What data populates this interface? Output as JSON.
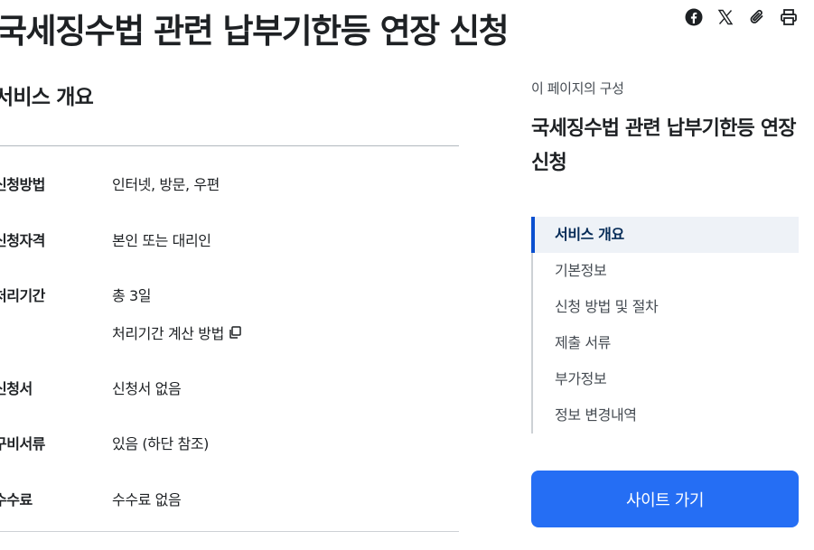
{
  "page": {
    "title": "국세징수법 관련 납부기한등 연장 신청"
  },
  "share_tools": [
    {
      "name": "facebook-icon"
    },
    {
      "name": "x-icon"
    },
    {
      "name": "paperclip-icon"
    },
    {
      "name": "print-icon"
    }
  ],
  "overview": {
    "title": "서비스 개요",
    "rows": [
      {
        "label": "신청방법",
        "value": "인터넷, 방문, 우편"
      },
      {
        "label": "신청자격",
        "value": "본인 또는 대리인"
      },
      {
        "label": "처리기간",
        "value": "총 3일",
        "link": "처리기간 계산 방법",
        "link_icon": "copy-icon"
      },
      {
        "label": "신청서",
        "value": "신청서 없음"
      },
      {
        "label": "구비서류",
        "value": "있음 (하단 참조)"
      },
      {
        "label": "수수료",
        "value": "수수료 없음"
      }
    ]
  },
  "toc": {
    "caption": "이 페이지의 구성",
    "title": "국세징수법 관련 납부기한등 연장 신청",
    "items": [
      {
        "label": "서비스 개요",
        "active": true
      },
      {
        "label": "기본정보"
      },
      {
        "label": "신청 방법 및 절차"
      },
      {
        "label": "제출 서류"
      },
      {
        "label": "부가정보"
      },
      {
        "label": "정보 변경내역"
      }
    ]
  },
  "actions": {
    "site_button_label": "사이트 가기"
  },
  "colors": {
    "accent": "#256ef4",
    "active_toc_bg": "#eef2f7",
    "active_toc_text": "#052b57"
  }
}
